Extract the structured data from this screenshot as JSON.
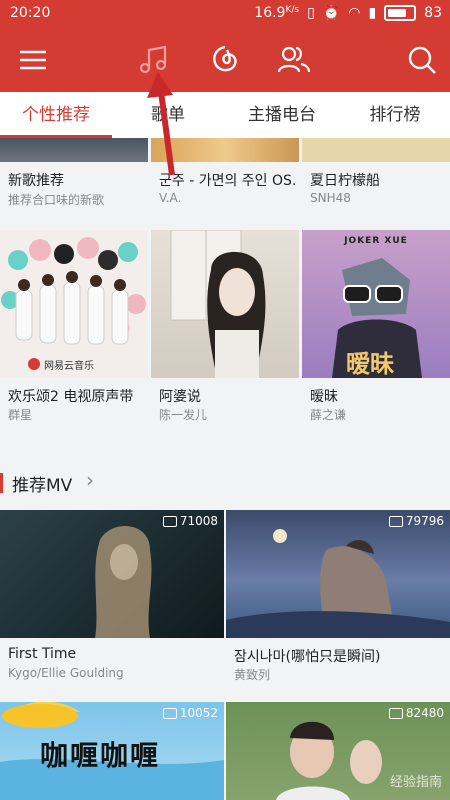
{
  "status": {
    "time": "20:20",
    "speed": "16.9",
    "speed_unit": "K/s",
    "battery": "83"
  },
  "toolbar": {
    "icons": [
      "menu-icon",
      "music-note-icon",
      "netease-logo-icon",
      "friends-icon",
      "search-icon"
    ]
  },
  "tabs": [
    {
      "label": "个性推荐",
      "active": true
    },
    {
      "label": "歌单"
    },
    {
      "label": "主播电台"
    },
    {
      "label": "排行榜"
    }
  ],
  "recommend_row1": [
    {
      "title": "新歌推荐",
      "sub": "推荐合口味的新歌"
    },
    {
      "title": "군주 - 가면의 주인 OS..",
      "sub": "V.A."
    },
    {
      "title": "夏日柠檬船",
      "sub": "SNH48"
    }
  ],
  "recommend_row2": [
    {
      "title": "欢乐颂2 电视原声带",
      "sub": "群星",
      "brand": "网易云音乐"
    },
    {
      "title": "阿婆说",
      "sub": "陈一发儿"
    },
    {
      "title": "暧昧",
      "sub": "薛之谦",
      "cover_text": "暧昧",
      "cover_top": "JOKER XUE"
    }
  ],
  "mv_section": {
    "title": "推荐MV"
  },
  "mvs": [
    {
      "title": "First Time",
      "sub": "Kygo/Ellie Goulding",
      "count": "71008"
    },
    {
      "title": "잠시나마(哪怕只是瞬间)",
      "sub": "黄致列",
      "count": "79796"
    },
    {
      "count": "10052",
      "cover_text": "咖喱咖喱"
    },
    {
      "count": "82480"
    }
  ],
  "watermark": "经验指南"
}
